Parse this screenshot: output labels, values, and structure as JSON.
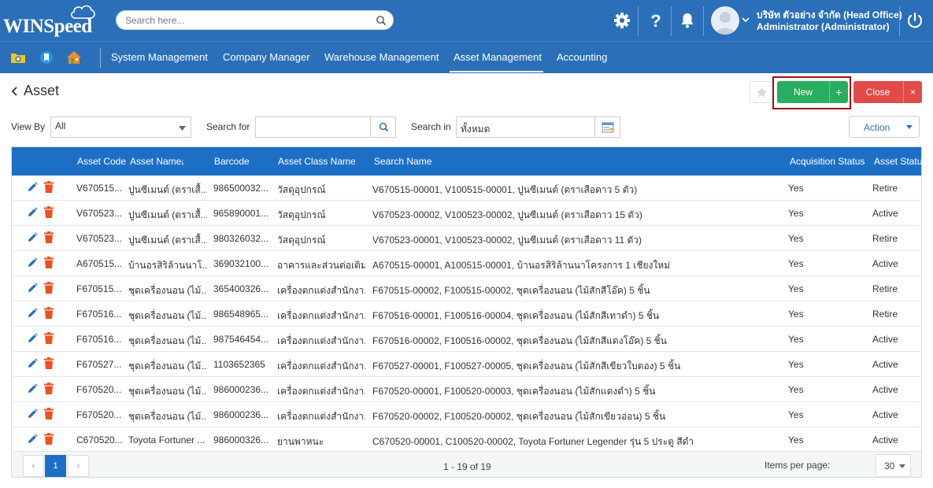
{
  "app": {
    "logo_text": "WINSpeed"
  },
  "header": {
    "search_placeholder": "Search here...",
    "company": "บริษัท ตัวอย่าง จำกัด (Head Office)",
    "user": "Administrator (Administrator)"
  },
  "nav": {
    "items": [
      {
        "label": "System Management"
      },
      {
        "label": "Company Manager"
      },
      {
        "label": "Warehouse Management"
      },
      {
        "label": "Asset Management"
      },
      {
        "label": "Accounting"
      }
    ],
    "active": "Asset Management"
  },
  "page": {
    "title": "Asset",
    "new_label": "New",
    "new_plus": "+",
    "close_label": "Close",
    "close_x": "×",
    "star": "★"
  },
  "filters": {
    "view_by_label": "View By",
    "view_by_value": "All",
    "search_for_label": "Search for",
    "search_for_value": "",
    "search_in_label": "Search in",
    "search_in_value": "ทั้งหมด",
    "action_label": "Action"
  },
  "grid": {
    "columns": {
      "asset_code": "Asset Code",
      "asset_name": "Asset Name",
      "sort_arrow": "↓",
      "barcode": "Barcode",
      "asset_class": "Asset Class Name",
      "search_name": "Search Name",
      "acq_status": "Acquisition Status",
      "asset_status": "Asset Status"
    },
    "rows": [
      {
        "code": "V670515...",
        "name": "ปูนซีเมนต์ (ตราเสื้...",
        "barcode": "986500032...",
        "class": "วัสดุอุปกรณ์",
        "search": "V670515-00001, V100515-00001, ปูนซีเมนต์ (ตราเสือดาว 5 ตัว)",
        "acq": "Yes",
        "status": "Retire"
      },
      {
        "code": "V670523...",
        "name": "ปูนซีเมนต์ (ตราเสื้...",
        "barcode": "965890001...",
        "class": "วัสดุอุปกรณ์",
        "search": "V670523-00002, V100523-00002, ปูนซีเมนต์ (ตราเสือดาว 15 ตัว)",
        "acq": "Yes",
        "status": "Active"
      },
      {
        "code": "V670523...",
        "name": "ปูนซีเมนต์ (ตราเสื้...",
        "barcode": "980326032...",
        "class": "วัสดุอุปกรณ์",
        "search": "V670523-00001, V100523-00002, ปูนซีเมนต์ (ตราเสือดาว 11 ตัว)",
        "acq": "Yes",
        "status": "Retire"
      },
      {
        "code": "A670515...",
        "name": "บ้านอรสิริล้านนาโ...",
        "barcode": "369032100...",
        "class": "อาคารและส่วนต่อเติม...",
        "search": "A670515-00001, A100515-00001, บ้านอรสิริล้านนาโครงการ 1 เชียงใหม่",
        "acq": "Yes",
        "status": "Active"
      },
      {
        "code": "F670515...",
        "name": "ชุดเครื่องนอน (ไม้...",
        "barcode": "365400326...",
        "class": "เครื่องตกแต่งสำนักงา...",
        "search": "F670515-00002, F100515-00002, ชุดเครื่องนอน (ไม้สักสีโอ๊ค) 5 ชิ้น",
        "acq": "Yes",
        "status": "Retire"
      },
      {
        "code": "F670516...",
        "name": "ชุดเครื่องนอน (ไม้...",
        "barcode": "986548965...",
        "class": "เครื่องตกแต่งสำนักงา...",
        "search": "F670516-00001, F100516-00004, ชุดเครื่องนอน (ไม้สักสีเทาดำ) 5 ชิ้น",
        "acq": "Yes",
        "status": "Retire"
      },
      {
        "code": "F670516...",
        "name": "ชุดเครื่องนอน (ไม้...",
        "barcode": "987546454...",
        "class": "เครื่องตกแต่งสำนักงา...",
        "search": "F670516-00002, F100516-00002, ชุดเครื่องนอน (ไม้สักสีแดงโอ๊ค) 5 ชิ้น",
        "acq": "Yes",
        "status": "Active"
      },
      {
        "code": "F670527...",
        "name": "ชุดเครื่องนอน (ไม้...",
        "barcode": "1103652365",
        "class": "เครื่องตกแต่งสำนักงา...",
        "search": "F670527-00001, F100527-00005, ชุดเครื่องนอน (ไม้สักสีเขียวใบตอง) 5 ชิ้น",
        "acq": "Yes",
        "status": "Active"
      },
      {
        "code": "F670520...",
        "name": "ชุดเครื่องนอน (ไม้...",
        "barcode": "986000236...",
        "class": "เครื่องตกแต่งสำนักงา...",
        "search": "F670520-00001, F100520-00003, ชุดเครื่องนอน (ไม้สักแดงดำ) 5 ชิ้น",
        "acq": "Yes",
        "status": "Active"
      },
      {
        "code": "F670520...",
        "name": "ชุดเครื่องนอน (ไม้...",
        "barcode": "986000236...",
        "class": "เครื่องตกแต่งสำนักงา...",
        "search": "F670520-00002, F100520-00002, ชุดเครื่องนอน (ไม้สักเขียวอ่อน) 5 ชิ้น",
        "acq": "Yes",
        "status": "Active"
      },
      {
        "code": "C670520...",
        "name": "Toyota Fortuner ...",
        "barcode": "986000326...",
        "class": "ยานพาหนะ",
        "search": "C670520-00001, C100520-00002, Toyota Fortuner Legender รุ่น 5 ประตู สีดำ",
        "acq": "Yes",
        "status": "Active"
      }
    ]
  },
  "pagination": {
    "prev": "‹",
    "current": "1",
    "next": "›",
    "info": "1 - 19 of 19",
    "items_per_page_label": "Items per page:",
    "items_per_page": "30"
  },
  "colors": {
    "header_blue": "#2a6fb8",
    "grid_header_blue": "#1d6fc5",
    "new_green": "#27ae60",
    "close_red": "#e24a4a",
    "delete_orange": "#f0501e"
  }
}
